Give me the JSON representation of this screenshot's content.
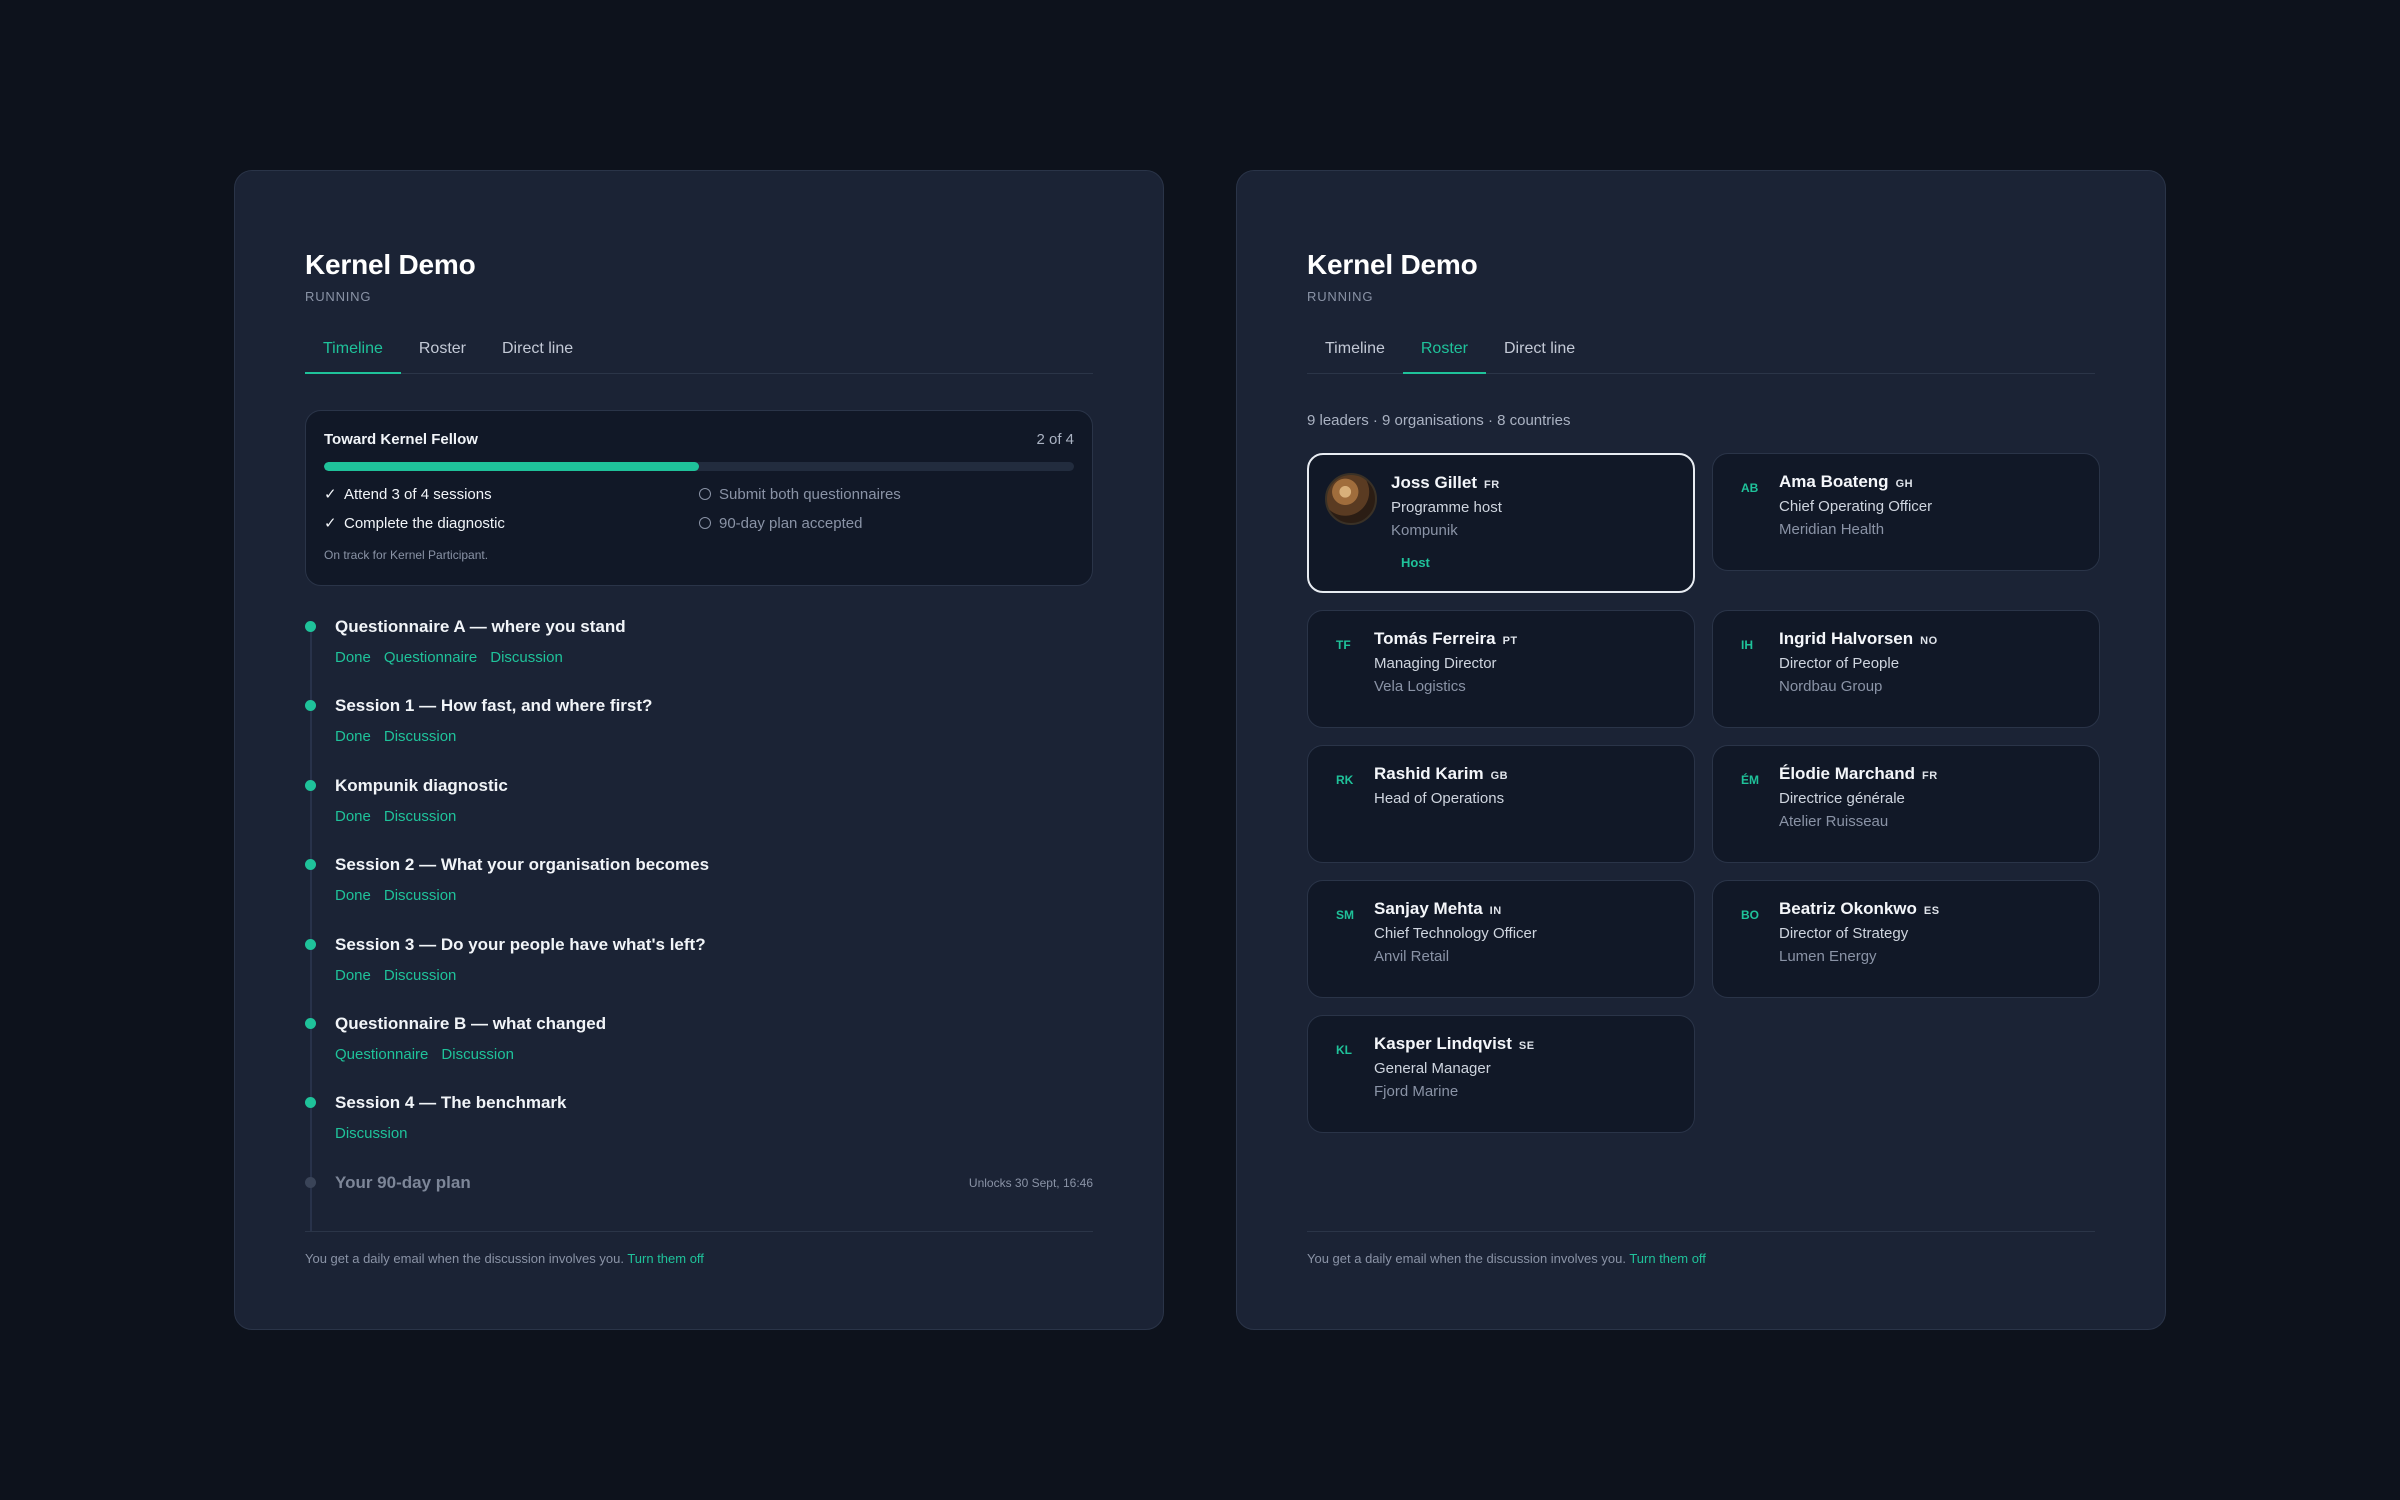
{
  "left": {
    "title": "Kernel Demo",
    "status": "RUNNING",
    "tabs": {
      "timeline": "Timeline",
      "roster": "Roster",
      "direct_line": "Direct line"
    },
    "progress": {
      "title": "Toward Kernel Fellow",
      "count": "2 of 4",
      "fraction": 0.5,
      "requirements": {
        "r1": {
          "check": "✓",
          "label": "Attend 3 of 4 sessions"
        },
        "r2": {
          "label": "Submit both questionnaires"
        },
        "r3": {
          "check": "✓",
          "label": "Complete the diagnostic"
        },
        "r4": {
          "label": "90-day plan accepted"
        }
      },
      "note": "On track for Kernel Participant."
    },
    "timeline": [
      {
        "title": "Questionnaire A — where you stand",
        "links": [
          "Done",
          "Questionnaire",
          "Discussion"
        ]
      },
      {
        "title": "Session 1 — How fast, and where first?",
        "links": [
          "Done",
          "Discussion"
        ]
      },
      {
        "title": "Kompunik diagnostic",
        "links": [
          "Done",
          "Discussion"
        ]
      },
      {
        "title": "Session 2 — What your organisation becomes",
        "links": [
          "Done",
          "Discussion"
        ]
      },
      {
        "title": "Session 3 — Do your people have what's left?",
        "links": [
          "Done",
          "Discussion"
        ]
      },
      {
        "title": "Questionnaire B — what changed",
        "links": [
          "Questionnaire",
          "Discussion"
        ]
      },
      {
        "title": "Session 4 — The benchmark",
        "links": [
          "Discussion"
        ]
      }
    ],
    "plan": {
      "title": "Your 90-day plan",
      "unlocks": "Unlocks 30 Sept, 16:46"
    },
    "footer": {
      "text": "You get a daily email when the discussion involves you.",
      "link": "Turn them off"
    }
  },
  "right": {
    "title": "Kernel Demo",
    "status": "RUNNING",
    "tabs": {
      "timeline": "Timeline",
      "roster": "Roster",
      "direct_line": "Direct line"
    },
    "summary": "9 leaders · 9 organisations · 8 countries",
    "host": {
      "name": "Joss Gillet",
      "country": "FR",
      "role": "Programme host",
      "org": "Kompunik",
      "badge": "Host"
    },
    "leaders": [
      {
        "initials": "AB",
        "name": "Ama Boateng",
        "country": "GH",
        "role": "Chief Operating Officer",
        "org": "Meridian Health"
      },
      {
        "initials": "TF",
        "name": "Tomás Ferreira",
        "country": "PT",
        "role": "Managing Director",
        "org": "Vela Logistics"
      },
      {
        "initials": "IH",
        "name": "Ingrid Halvorsen",
        "country": "NO",
        "role": "Director of People",
        "org": "Nordbau Group"
      },
      {
        "initials": "RK",
        "name": "Rashid Karim",
        "country": "GB",
        "role": "Head of Operations",
        "org": ""
      },
      {
        "initials": "ÉM",
        "name": "Élodie Marchand",
        "country": "FR",
        "role": "Directrice générale",
        "org": "Atelier Ruisseau"
      },
      {
        "initials": "SM",
        "name": "Sanjay Mehta",
        "country": "IN",
        "role": "Chief Technology Officer",
        "org": "Anvil Retail"
      },
      {
        "initials": "BO",
        "name": "Beatriz Okonkwo",
        "country": "ES",
        "role": "Director of Strategy",
        "org": "Lumen Energy"
      },
      {
        "initials": "KL",
        "name": "Kasper Lindqvist",
        "country": "SE",
        "role": "General Manager",
        "org": "Fjord Marine"
      }
    ],
    "footer": {
      "text": "You get a daily email when the discussion involves you.",
      "link": "Turn them off"
    }
  },
  "colors": {
    "accent": "#1fc29a",
    "background": "#0d121c",
    "panel": "#1b2335",
    "card": "#111827"
  }
}
